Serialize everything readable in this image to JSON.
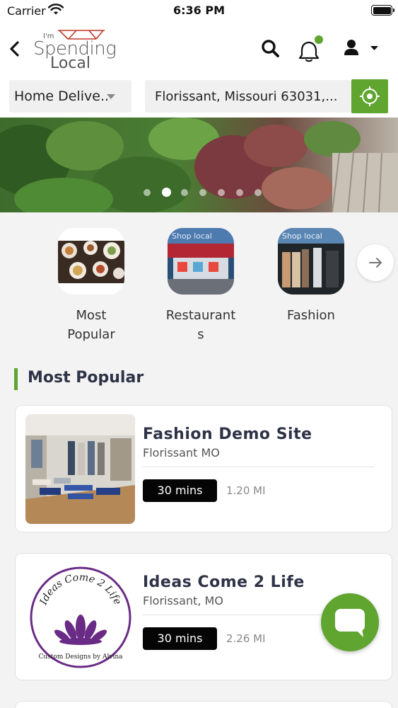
{
  "status_bar": {
    "carrier": "Carrier",
    "time": "6:36 PM"
  },
  "header": {
    "logo": {
      "line1": "I'm",
      "line2": "Spending",
      "line3": "Local"
    }
  },
  "filters": {
    "delivery_mode": "Home Delive...",
    "location": "Florissant, Missouri 63031,..."
  },
  "banner": {
    "slide_count": 7,
    "active_slide": 2
  },
  "categories": [
    {
      "label_line1": "Most",
      "label_line2": "Popular"
    },
    {
      "label_line1": "Restaurant",
      "label_line2": "s"
    },
    {
      "label_line1": "Fashion",
      "label_line2": ""
    }
  ],
  "section": {
    "title": "Most Popular"
  },
  "stores": [
    {
      "name": "Fashion Demo Site",
      "city": "Florissant MO",
      "time": "30 mins",
      "distance": "1.20 MI"
    },
    {
      "name": "Ideas Come 2 Life",
      "city": "Florissant, MO",
      "time": "30 mins",
      "distance": "2.26 MI",
      "logo_text_top": "Ideas Come 2 Life",
      "logo_text_bottom": "Custom Designs by Alvina"
    }
  ],
  "colors": {
    "accent": "#5fa52f",
    "title": "#2e3246"
  }
}
